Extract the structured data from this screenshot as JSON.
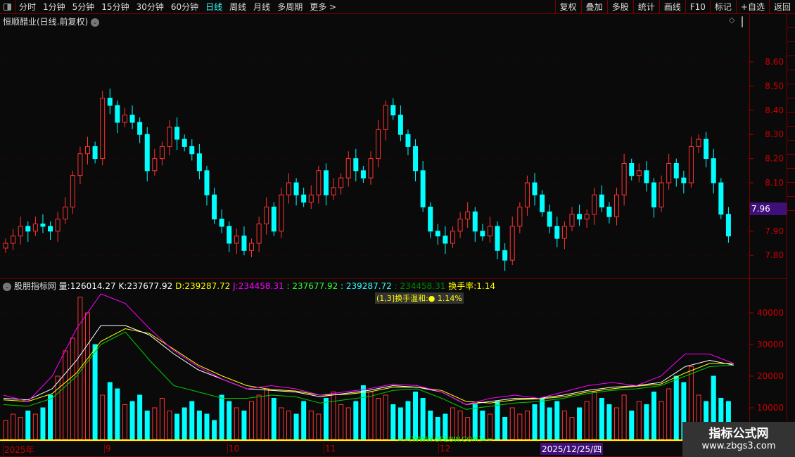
{
  "toolbar": {
    "periods": [
      "分时",
      "1分钟",
      "5分钟",
      "15分钟",
      "30分钟",
      "60分钟",
      "日线",
      "周线",
      "月线",
      "多周期",
      "更多 >"
    ],
    "active": "日线",
    "buttons": [
      "复权",
      "叠加",
      "多股",
      "统计",
      "画线",
      "F10",
      "标记",
      "+自选",
      "返回"
    ]
  },
  "main": {
    "title": "恒顺醋业(日线.前复权)",
    "price_tag": "7.96",
    "y_ticks": [
      "8.60",
      "8.50",
      "8.40",
      "8.30",
      "8.20",
      "8.10",
      "7.90",
      "7.80"
    ]
  },
  "indicator": {
    "name": "股朋指标网",
    "vol_label": "量:",
    "vol": "126014.27",
    "k_label": "K:",
    "k": "237677.92",
    "d_label": "D:",
    "d": "239287.72",
    "j_label": "J:",
    "j": "234458.31",
    "v4": ": 237677.92",
    "v5": ": 239287.72",
    "v6": ": 234458.31",
    "turn_label": "换手率:",
    "turn": "1.14",
    "turn_box": "(1,3]换手温和:● 1.14%",
    "y_ticks": [
      "40000",
      "30000",
      "20000",
      "10000"
    ],
    "site": "==[WWW.GPZBW.COM]=="
  },
  "time_axis": {
    "labels": [
      "2025年",
      "9",
      "10",
      "11",
      "12"
    ],
    "cursor_date": "2025/12/25/四"
  },
  "watermark": {
    "line1": "指标公式网",
    "line2": "www.zbgs3.com"
  },
  "colors": {
    "up": "#ff3333",
    "down": "#00ffff",
    "k": "#ffffff",
    "d": "#ffff00",
    "j": "#ff00ff",
    "green": "#00cc00",
    "axis": "#cc0000"
  },
  "chart_data": {
    "type": "candlestick",
    "ylim": [
      7.75,
      8.72
    ],
    "close": [
      7.85,
      7.88,
      7.92,
      7.9,
      7.93,
      7.92,
      7.9,
      7.95,
      8.0,
      8.13,
      8.22,
      8.25,
      8.2,
      8.45,
      8.42,
      8.35,
      8.38,
      8.35,
      8.3,
      8.15,
      8.2,
      8.25,
      8.33,
      8.28,
      8.25,
      8.22,
      8.15,
      8.05,
      7.95,
      7.92,
      7.85,
      7.88,
      7.82,
      7.85,
      7.93,
      8.0,
      7.9,
      8.05,
      8.1,
      8.05,
      8.02,
      8.05,
      8.15,
      8.05,
      8.08,
      8.12,
      8.2,
      8.15,
      8.12,
      8.2,
      8.32,
      8.42,
      8.38,
      8.3,
      8.25,
      8.15,
      8.0,
      7.9,
      7.88,
      7.85,
      7.9,
      7.95,
      7.98,
      7.9,
      7.88,
      7.92,
      7.82,
      7.78,
      7.92,
      8.0,
      8.1,
      8.05,
      7.98,
      7.92,
      7.87,
      7.92,
      7.97,
      7.95,
      7.97,
      8.05,
      8.0,
      7.96,
      8.05,
      8.18,
      8.13,
      8.15,
      8.1,
      8.0,
      8.1,
      8.18,
      8.12,
      8.1,
      8.25,
      8.28,
      8.2,
      8.1,
      7.97,
      7.88
    ],
    "volume": [
      6000,
      8000,
      7000,
      9000,
      8000,
      10000,
      14000,
      20000,
      28000,
      32000,
      45000,
      40000,
      30000,
      14000,
      18000,
      16000,
      11000,
      12000,
      14000,
      9000,
      10000,
      13000,
      9000,
      8000,
      10000,
      12000,
      9000,
      8000,
      6000,
      14000,
      12000,
      10000,
      9000,
      12000,
      14000,
      16000,
      13000,
      10000,
      9000,
      8000,
      12000,
      9000,
      8000,
      13000,
      15000,
      11000,
      10000,
      12000,
      17000,
      15000,
      13000,
      14000,
      11000,
      10000,
      12000,
      15000,
      13000,
      9000,
      7000,
      8000,
      10000,
      9000,
      7000,
      11000,
      9000,
      8000,
      12000,
      7000,
      10000,
      8000,
      9000,
      11000,
      13000,
      10000,
      12000,
      9000,
      7000,
      10000,
      12000,
      15000,
      13000,
      11000,
      10000,
      14000,
      9000,
      12000,
      11000,
      15000,
      12000,
      16000,
      20000,
      18000,
      23000,
      14000,
      12000,
      20000,
      13000,
      12000
    ],
    "k": [
      13000,
      12500,
      16000,
      25000,
      36000,
      36000,
      33000,
      27000,
      22000,
      19000,
      16000,
      15500,
      15000,
      13500,
      14500,
      15500,
      17000,
      16500,
      15000,
      11000,
      12000,
      13000,
      13000,
      14000,
      15500,
      16500,
      17000,
      18000,
      23000,
      25000,
      23500
    ],
    "d": [
      12500,
      12000,
      14500,
      21000,
      31000,
      35000,
      33500,
      28500,
      23500,
      20000,
      17000,
      15800,
      15300,
      14000,
      14200,
      15000,
      16500,
      16500,
      15500,
      12000,
      11500,
      12500,
      12800,
      13500,
      15000,
      16000,
      16800,
      17500,
      21000,
      24000,
      24000
    ],
    "j": [
      14000,
      12000,
      20000,
      35000,
      46000,
      43000,
      35000,
      28000,
      23000,
      19000,
      16000,
      17000,
      16000,
      14000,
      15000,
      16000,
      17500,
      17000,
      15000,
      11000,
      13000,
      14000,
      13000,
      15000,
      17000,
      18000,
      17000,
      20000,
      27000,
      27000,
      24000
    ],
    "green": [
      11000,
      10500,
      13000,
      20000,
      30000,
      34000,
      25000,
      17000,
      15000,
      13000,
      13000,
      14000,
      13500,
      11500,
      12500,
      13500,
      15500,
      16000,
      13000,
      9500,
      10500,
      11500,
      12000,
      13000,
      14500,
      15500,
      16000,
      17000,
      20000,
      23000,
      23500
    ]
  }
}
